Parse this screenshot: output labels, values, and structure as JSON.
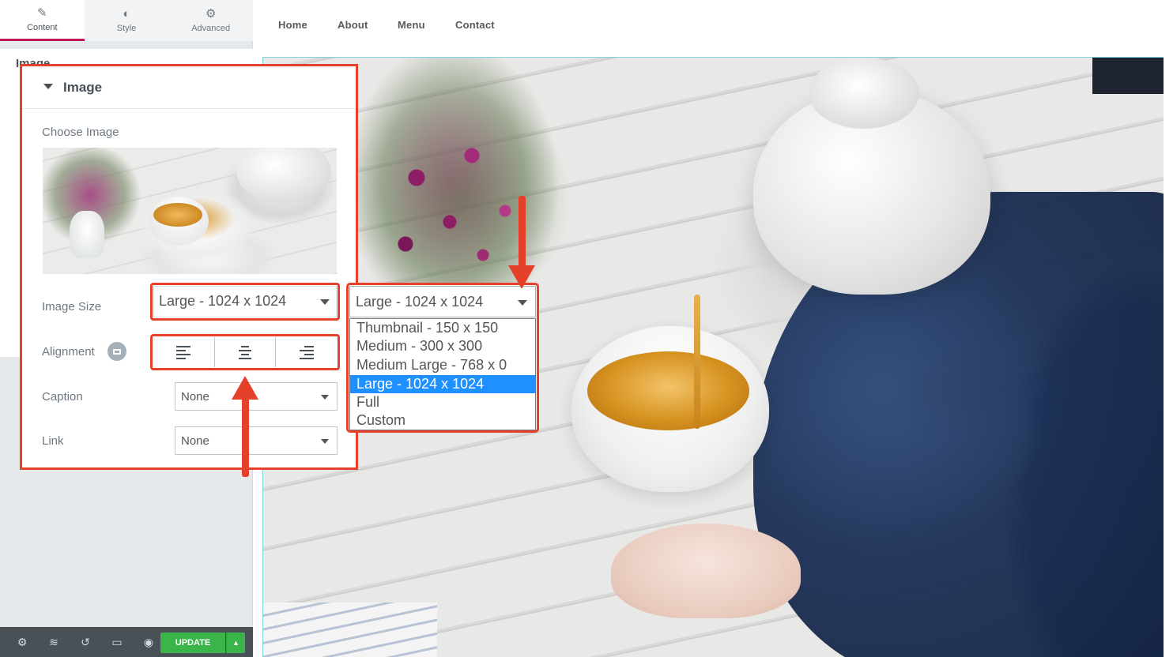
{
  "editor": {
    "tabs": [
      {
        "label": "Content",
        "icon": "pencil-icon"
      },
      {
        "label": "Style",
        "icon": "contrast-icon"
      },
      {
        "label": "Advanced",
        "icon": "gear-icon"
      }
    ],
    "background_section_title": "Image",
    "bottom_bar": {
      "icons": [
        "gear-icon",
        "layers-icon",
        "history-icon",
        "responsive-icon",
        "eye-icon"
      ],
      "update_label": "UPDATE",
      "update_caret": "▲"
    }
  },
  "nav": {
    "links": [
      "Home",
      "About",
      "Menu",
      "Contact"
    ]
  },
  "image_panel": {
    "title": "Image",
    "choose_image_label": "Choose Image",
    "image_size": {
      "label": "Image Size",
      "value": "Large - 1024 x 1024"
    },
    "alignment": {
      "label": "Alignment",
      "options": [
        "left-align-icon",
        "center-align-icon",
        "right-align-icon"
      ]
    },
    "caption": {
      "label": "Caption",
      "value": "None"
    },
    "link": {
      "label": "Link",
      "value": "None"
    }
  },
  "image_size_dropdown": {
    "selected": "Large - 1024 x 1024",
    "options": [
      "Thumbnail - 150 x 150",
      "Medium - 300 x 300",
      "Medium Large - 768 x 0",
      "Large - 1024 x 1024",
      "Full",
      "Custom"
    ],
    "selected_index": 3
  },
  "colors": {
    "highlight": "#e5412a",
    "update_button": "#39b54a",
    "active_tab_accent": "#c2185b",
    "dropdown_selected": "#1e90ff"
  }
}
